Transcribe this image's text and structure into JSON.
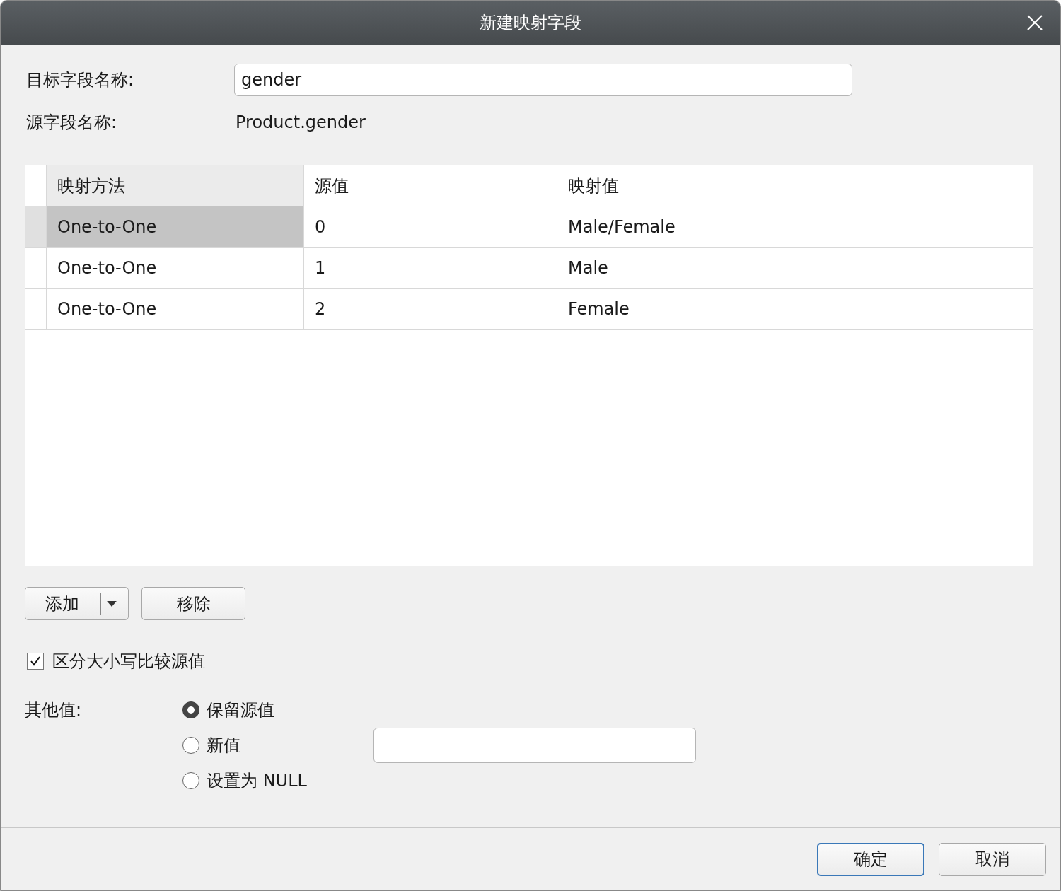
{
  "window": {
    "title": "新建映射字段"
  },
  "target_field": {
    "label": "目标字段名称:",
    "value": "gender"
  },
  "source_field": {
    "label": "源字段名称:",
    "value": "Product.gender"
  },
  "table": {
    "columns": [
      {
        "label": "映射方法",
        "selected": true
      },
      {
        "label": "源值",
        "selected": false
      },
      {
        "label": "映射值",
        "selected": false
      }
    ],
    "rows": [
      {
        "cells": [
          "One-to-One",
          "0",
          "Male/Female"
        ],
        "selected": true
      },
      {
        "cells": [
          "One-to-One",
          "1",
          "Male"
        ],
        "selected": false
      },
      {
        "cells": [
          "One-to-One",
          "2",
          "Female"
        ],
        "selected": false
      }
    ]
  },
  "buttons": [
    {
      "label": "添加",
      "kind": "split"
    },
    {
      "label": "移除",
      "kind": "plain"
    }
  ],
  "case_sensitive": {
    "label": "区分大小写比较源值",
    "checked": true
  },
  "other_values": {
    "label": "其他值:",
    "options": [
      {
        "label": "保留源值",
        "selected": true
      },
      {
        "label": "新值",
        "selected": false
      },
      {
        "label": "设置为 NULL",
        "selected": false
      }
    ]
  },
  "dialog_buttons": [
    {
      "label": "确定",
      "default": true
    },
    {
      "label": "取消",
      "default": false
    }
  ]
}
